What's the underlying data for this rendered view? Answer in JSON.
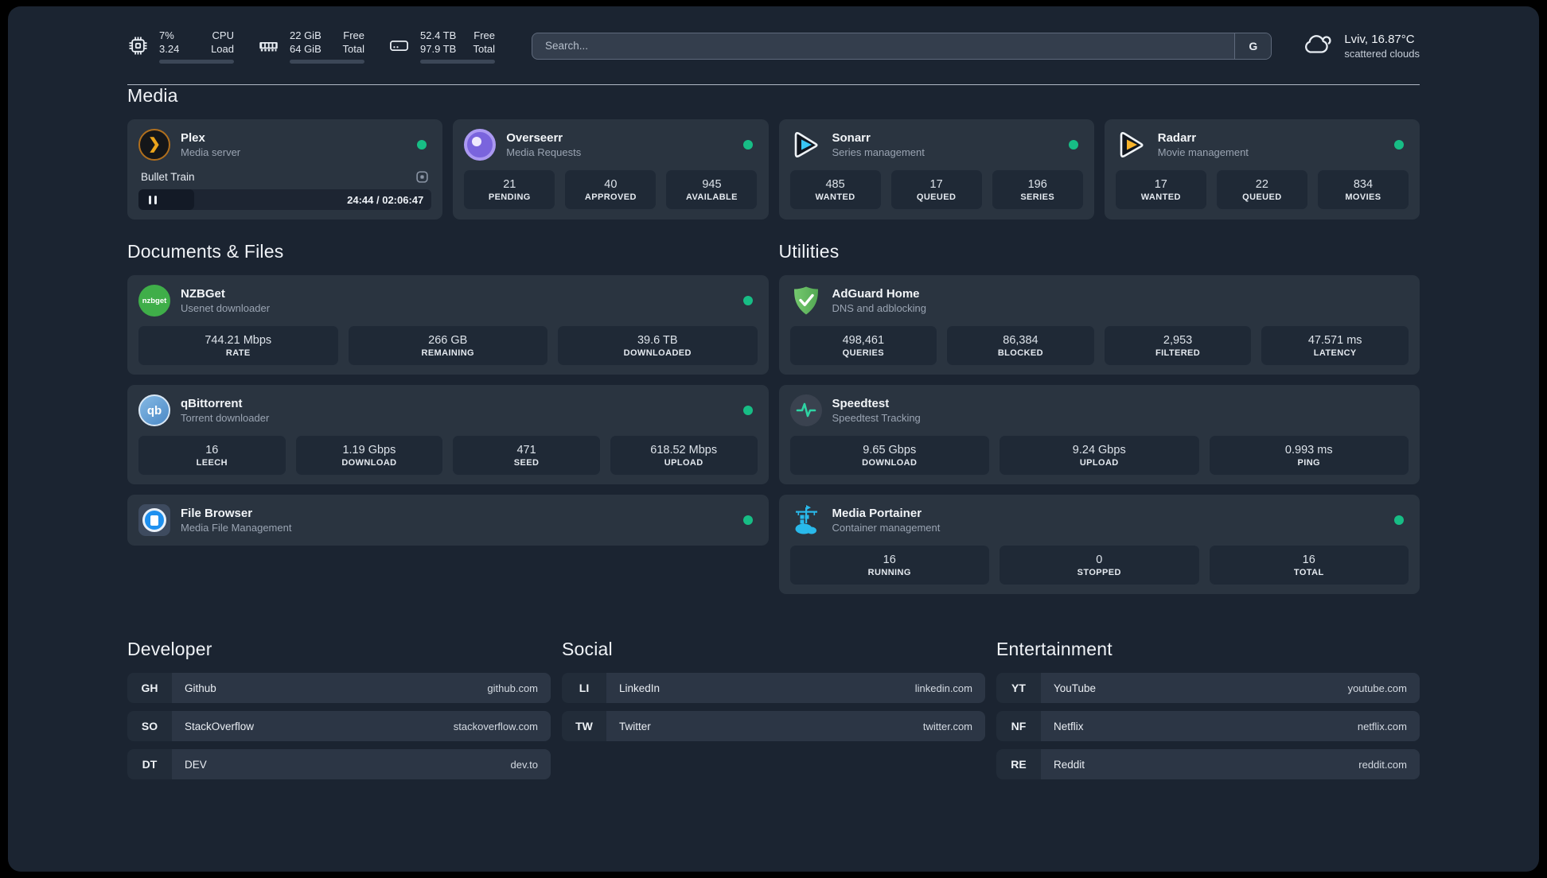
{
  "colors": {
    "status_online": "#17bd85",
    "background": "#1b2431",
    "card": "#2a3440"
  },
  "header": {
    "stats": [
      {
        "icon": "cpu-icon",
        "rows": [
          {
            "value": "7%",
            "label": "CPU"
          },
          {
            "value": "3.24",
            "label": "Load"
          }
        ],
        "progress_pct": 10
      },
      {
        "icon": "ram-icon",
        "rows": [
          {
            "value": "22 GiB",
            "label": "Free"
          },
          {
            "value": "64 GiB",
            "label": "Total"
          }
        ],
        "progress_pct": 65
      },
      {
        "icon": "disk-icon",
        "rows": [
          {
            "value": "52.4 TB",
            "label": "Free"
          },
          {
            "value": "97.9 TB",
            "label": "Total"
          }
        ],
        "progress_pct": 46
      }
    ],
    "search": {
      "placeholder": "Search...",
      "provider_button": "G"
    },
    "weather": {
      "location": "Lviv, 16.87°C",
      "condition": "scattered clouds"
    }
  },
  "media": {
    "title": "Media",
    "cards": [
      {
        "name": "Plex",
        "description": "Media server",
        "online": true,
        "player": {
          "title": "Bullet Train",
          "time": "24:44 / 02:06:47",
          "progress_pct": 19,
          "state": "paused"
        }
      },
      {
        "name": "Overseerr",
        "description": "Media Requests",
        "online": true,
        "stats": [
          {
            "value": "21",
            "label": "PENDING"
          },
          {
            "value": "40",
            "label": "APPROVED"
          },
          {
            "value": "945",
            "label": "AVAILABLE"
          }
        ]
      },
      {
        "name": "Sonarr",
        "description": "Series management",
        "online": true,
        "stats": [
          {
            "value": "485",
            "label": "WANTED"
          },
          {
            "value": "17",
            "label": "QUEUED"
          },
          {
            "value": "196",
            "label": "SERIES"
          }
        ]
      },
      {
        "name": "Radarr",
        "description": "Movie management",
        "online": true,
        "stats": [
          {
            "value": "17",
            "label": "WANTED"
          },
          {
            "value": "22",
            "label": "QUEUED"
          },
          {
            "value": "834",
            "label": "MOVIES"
          }
        ]
      }
    ]
  },
  "documents": {
    "title": "Documents & Files",
    "cards": [
      {
        "name": "NZBGet",
        "description": "Usenet downloader",
        "online": true,
        "stats": [
          {
            "value": "744.21 Mbps",
            "label": "RATE"
          },
          {
            "value": "266 GB",
            "label": "REMAINING"
          },
          {
            "value": "39.6 TB",
            "label": "DOWNLOADED"
          }
        ]
      },
      {
        "name": "qBittorrent",
        "description": "Torrent downloader",
        "online": true,
        "stats": [
          {
            "value": "16",
            "label": "LEECH"
          },
          {
            "value": "1.19 Gbps",
            "label": "DOWNLOAD"
          },
          {
            "value": "471",
            "label": "SEED"
          },
          {
            "value": "618.52 Mbps",
            "label": "UPLOAD"
          }
        ]
      },
      {
        "name": "File Browser",
        "description": "Media File Management",
        "online": true
      }
    ]
  },
  "utilities": {
    "title": "Utilities",
    "cards": [
      {
        "name": "AdGuard Home",
        "description": "DNS and adblocking",
        "stats": [
          {
            "value": "498,461",
            "label": "QUERIES"
          },
          {
            "value": "86,384",
            "label": "BLOCKED"
          },
          {
            "value": "2,953",
            "label": "FILTERED"
          },
          {
            "value": "47.571 ms",
            "label": "LATENCY"
          }
        ]
      },
      {
        "name": "Speedtest",
        "description": "Speedtest Tracking",
        "stats": [
          {
            "value": "9.65 Gbps",
            "label": "DOWNLOAD"
          },
          {
            "value": "9.24 Gbps",
            "label": "UPLOAD"
          },
          {
            "value": "0.993 ms",
            "label": "PING"
          }
        ]
      },
      {
        "name": "Media Portainer",
        "description": "Container management",
        "online": true,
        "stats": [
          {
            "value": "16",
            "label": "RUNNING"
          },
          {
            "value": "0",
            "label": "STOPPED"
          },
          {
            "value": "16",
            "label": "TOTAL"
          }
        ]
      }
    ]
  },
  "bookmarks": [
    {
      "title": "Developer",
      "items": [
        {
          "abbr": "GH",
          "name": "Github",
          "url": "github.com"
        },
        {
          "abbr": "SO",
          "name": "StackOverflow",
          "url": "stackoverflow.com"
        },
        {
          "abbr": "DT",
          "name": "DEV",
          "url": "dev.to"
        }
      ]
    },
    {
      "title": "Social",
      "items": [
        {
          "abbr": "LI",
          "name": "LinkedIn",
          "url": "linkedin.com"
        },
        {
          "abbr": "TW",
          "name": "Twitter",
          "url": "twitter.com"
        }
      ]
    },
    {
      "title": "Entertainment",
      "items": [
        {
          "abbr": "YT",
          "name": "YouTube",
          "url": "youtube.com"
        },
        {
          "abbr": "NF",
          "name": "Netflix",
          "url": "netflix.com"
        },
        {
          "abbr": "RE",
          "name": "Reddit",
          "url": "reddit.com"
        }
      ]
    }
  ]
}
